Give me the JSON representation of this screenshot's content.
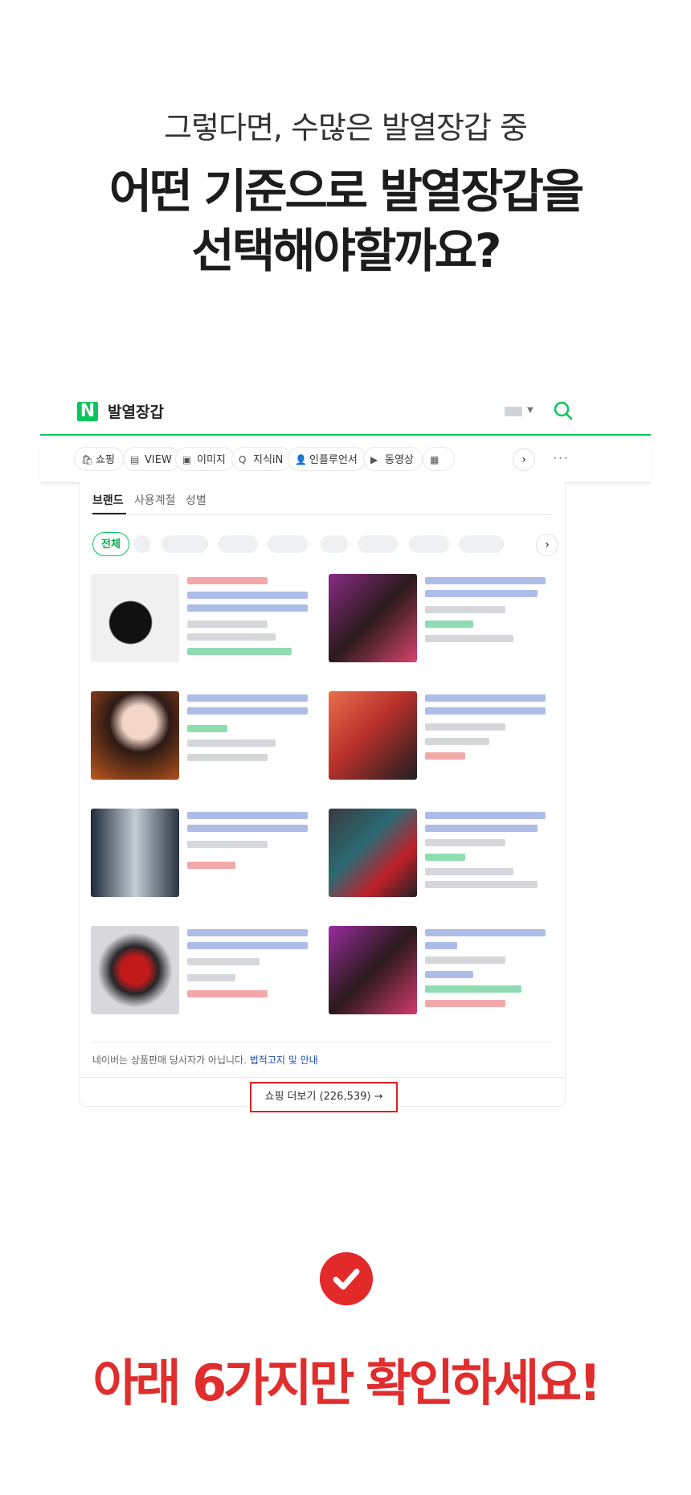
{
  "hero": {
    "subtitle": "그렇다면, 수많은 발열장갑 중",
    "title_line1": "어떤 기준으로 발열장갑을",
    "title_line2": "선택해야할까요?"
  },
  "search": {
    "logo": "N",
    "query": "발열장갑"
  },
  "tabs": [
    {
      "icon": "shopping-bag-icon",
      "glyph": "🛍",
      "label": "쇼핑"
    },
    {
      "icon": "document-icon",
      "glyph": "▤",
      "label": "VIEW"
    },
    {
      "icon": "image-icon",
      "glyph": "▣",
      "label": "이미지"
    },
    {
      "icon": "q-icon",
      "glyph": "Q",
      "label": "지식iN"
    },
    {
      "icon": "person-icon",
      "glyph": "👤",
      "label": "인플루언서"
    },
    {
      "icon": "play-icon",
      "glyph": "▶",
      "label": "동영상"
    },
    {
      "icon": "news-icon",
      "glyph": "▦",
      "label": ""
    }
  ],
  "filters": {
    "tabs": [
      "브랜드",
      "사용계절",
      "성별"
    ],
    "active_chip": "전체"
  },
  "notice": {
    "text": "네이버는 상품판매 당사자가 아닙니다.",
    "link": "법적고지 및 안내"
  },
  "more_button": "쇼핑 더보기 (226,539) →",
  "cta": "아래 6가지만 확인하세요!",
  "colors": {
    "naver_green": "#03c75a",
    "accent_red": "#e02d2d"
  }
}
